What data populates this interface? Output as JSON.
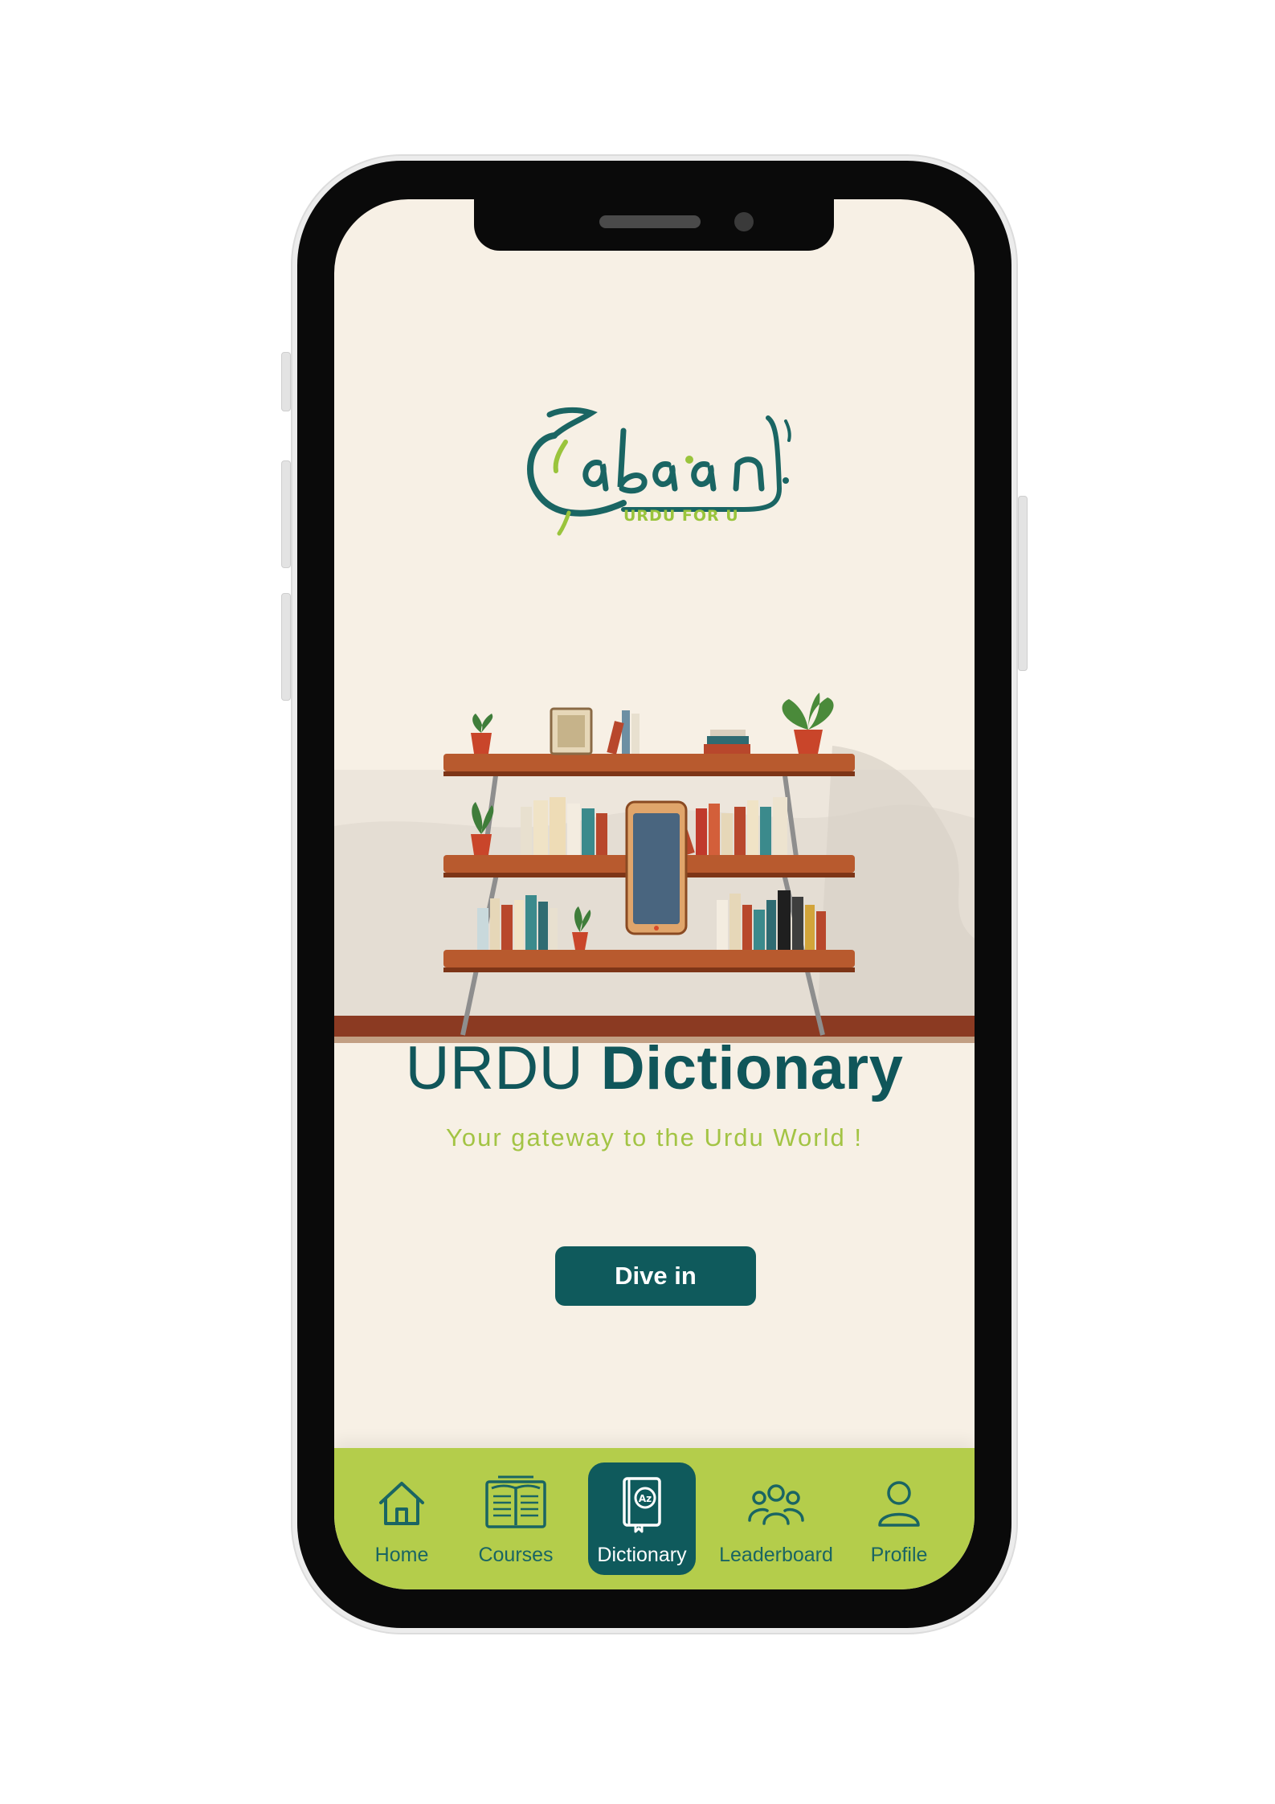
{
  "app": {
    "logo_wordmark": "Zabaan",
    "logo_tagline": "URDU FOR U"
  },
  "hero": {
    "title_light": "URDU",
    "title_bold": "Dictionary",
    "subtitle": "Your gateway to the Urdu World !",
    "cta_label": "Dive in"
  },
  "nav": {
    "items": [
      {
        "label": "Home",
        "icon": "home-icon",
        "active": false
      },
      {
        "label": "Courses",
        "icon": "open-book-icon",
        "active": false
      },
      {
        "label": "Dictionary",
        "icon": "dictionary-book-icon",
        "active": true
      },
      {
        "label": "Leaderboard",
        "icon": "group-users-icon",
        "active": false
      },
      {
        "label": "Profile",
        "icon": "user-icon",
        "active": false
      }
    ]
  },
  "colors": {
    "screen_bg": "#f7f0e5",
    "primary": "#0f5a5c",
    "accent": "#b4cd4b",
    "subtitle": "#a3c444",
    "nav_text": "#1a6563"
  }
}
